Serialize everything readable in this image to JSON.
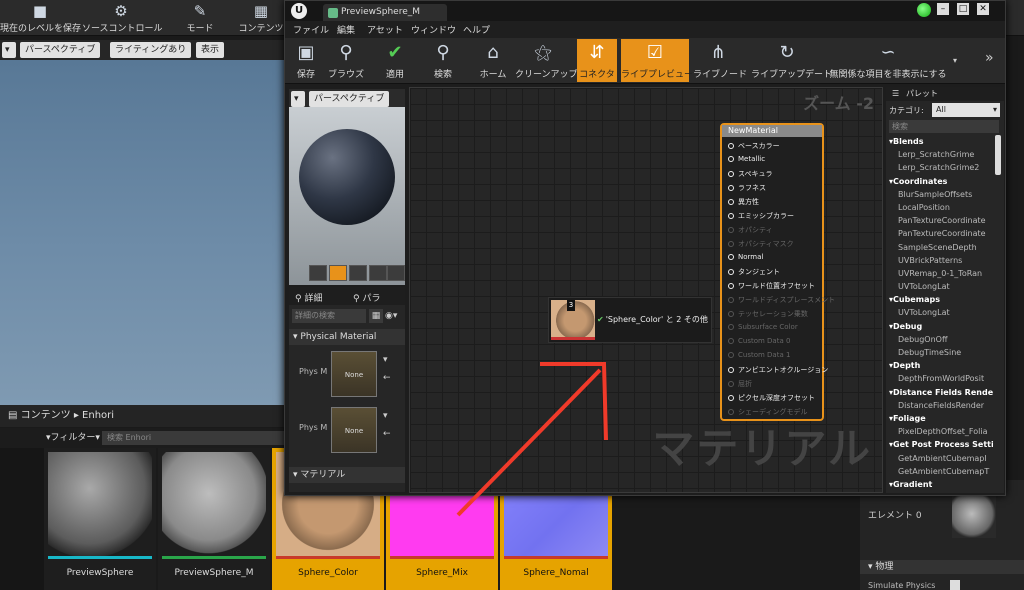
{
  "main_toolbar": {
    "items": [
      {
        "label": "現在のレベルを保存",
        "icon": "save-icon"
      },
      {
        "label": "ソースコントロール",
        "icon": "source-control-icon"
      },
      {
        "label": "モード",
        "icon": "modes-icon"
      },
      {
        "label": "コンテンツ",
        "icon": "content-icon"
      }
    ]
  },
  "left_viewport": {
    "perspective": "パースペクティブ",
    "lighting": "ライティングあり",
    "show": "表示"
  },
  "content_browser": {
    "title": "コンテンツ",
    "path": "Enhori",
    "filter_label": "フィルター",
    "search_placeholder": "検索 Enhori",
    "assets": [
      {
        "name": "PreviewSphere",
        "selected": false,
        "color": "#18b8c8"
      },
      {
        "name": "PreviewSphere_M",
        "selected": false,
        "color": "#2aa64a"
      },
      {
        "name": "Sphere_Color",
        "selected": true,
        "color": "#c83a2a"
      },
      {
        "name": "Sphere_Mix",
        "selected": true,
        "color": "#c83a2a"
      },
      {
        "name": "Sphere_Nomal",
        "selected": true,
        "color": "#c83a2a"
      }
    ]
  },
  "right_panel": {
    "element_label": "エレメント 0",
    "physics_header": "物理",
    "simulate_physics": "Simulate Physics"
  },
  "material_editor": {
    "tab_title": "PreviewSphere_M",
    "menu": [
      "ファイル",
      "編集",
      "アセット",
      "ウィンドウ",
      "ヘルプ"
    ],
    "toolbar": [
      {
        "label": "保存",
        "icon": "save-icon",
        "active": false
      },
      {
        "label": "ブラウズ",
        "icon": "browse-icon",
        "active": false
      },
      {
        "label": "適用",
        "icon": "apply-icon",
        "active": false
      },
      {
        "label": "検索",
        "icon": "search-icon",
        "active": false
      },
      {
        "label": "ホーム",
        "icon": "home-icon",
        "active": false
      },
      {
        "label": "クリーンアップ",
        "icon": "cleanup-icon",
        "active": false
      },
      {
        "label": "コネクタ",
        "icon": "connector-icon",
        "active": true
      },
      {
        "label": "ライブプレビュー",
        "icon": "live-preview-icon",
        "active": true
      },
      {
        "label": "ライブノード",
        "icon": "live-nodes-icon",
        "active": false
      },
      {
        "label": "ライブアップデート",
        "icon": "live-update-icon",
        "active": false
      },
      {
        "label": "無関係な項目を非表示にする",
        "icon": "hide-unrelated-icon",
        "active": false
      }
    ],
    "preview": {
      "perspective": "パースペクティブ"
    },
    "details": {
      "tab_details": "詳細",
      "tab_params": "パラ",
      "search_placeholder": "詳細の検索",
      "section_physical": "Physical Material",
      "phys_label": "Phys M",
      "phys_value": "None",
      "section_material": "マテリアル"
    },
    "graph": {
      "zoom": "ズーム -2",
      "watermark": "マテリアル",
      "node_title": "NewMaterial",
      "pins": [
        {
          "label": "ベースカラー",
          "enabled": true
        },
        {
          "label": "Metallic",
          "enabled": true
        },
        {
          "label": "スペキュラ",
          "enabled": true
        },
        {
          "label": "ラフネス",
          "enabled": true
        },
        {
          "label": "異方性",
          "enabled": true
        },
        {
          "label": "エミッシブカラー",
          "enabled": true
        },
        {
          "label": "オパシティ",
          "enabled": false
        },
        {
          "label": "オパシティマスク",
          "enabled": false
        },
        {
          "label": "Normal",
          "enabled": true
        },
        {
          "label": "タンジェント",
          "enabled": true
        },
        {
          "label": "ワールド位置オフセット",
          "enabled": true
        },
        {
          "label": "ワールドディスプレースメント",
          "enabled": false
        },
        {
          "label": "テッセレーション乗数",
          "enabled": false
        },
        {
          "label": "Subsurface Color",
          "enabled": false
        },
        {
          "label": "Custom Data 0",
          "enabled": false
        },
        {
          "label": "Custom Data 1",
          "enabled": false
        },
        {
          "label": "アンビエントオクルージョン",
          "enabled": true
        },
        {
          "label": "屈折",
          "enabled": false
        },
        {
          "label": "ピクセル深度オフセット",
          "enabled": true
        },
        {
          "label": "シェーディングモデル",
          "enabled": false
        }
      ],
      "drag": {
        "count": "3",
        "text": "'Sphere_Color' と 2 その他"
      }
    },
    "palette": {
      "title": "パレット",
      "category_label": "カテゴリ:",
      "category_value": "All",
      "search_placeholder": "検索",
      "rows": [
        {
          "text": "Blends",
          "head": true
        },
        {
          "text": "Lerp_ScratchGrime",
          "head": false
        },
        {
          "text": "Lerp_ScratchGrime2",
          "head": false
        },
        {
          "text": "Coordinates",
          "head": true
        },
        {
          "text": "BlurSampleOffsets",
          "head": false
        },
        {
          "text": "LocalPosition",
          "head": false
        },
        {
          "text": "PanTextureCoordinate",
          "head": false
        },
        {
          "text": "PanTextureCoordinate",
          "head": false
        },
        {
          "text": "SampleSceneDepth",
          "head": false
        },
        {
          "text": "UVBrickPatterns",
          "head": false
        },
        {
          "text": "UVRemap_0-1_ToRan",
          "head": false
        },
        {
          "text": "UVToLongLat",
          "head": false
        },
        {
          "text": "Cubemaps",
          "head": true
        },
        {
          "text": "UVToLongLat",
          "head": false
        },
        {
          "text": "Debug",
          "head": true
        },
        {
          "text": "DebugOnOff",
          "head": false
        },
        {
          "text": "DebugTimeSine",
          "head": false
        },
        {
          "text": "Depth",
          "head": true
        },
        {
          "text": "DepthFromWorldPosit",
          "head": false
        },
        {
          "text": "Distance Fields Renderin",
          "head": true
        },
        {
          "text": "DistanceFieldsRender",
          "head": false
        },
        {
          "text": "Foliage",
          "head": true
        },
        {
          "text": "PixelDepthOffset_Folia",
          "head": false
        },
        {
          "text": "Get Post Process Setting",
          "head": true
        },
        {
          "text": "GetAmbientCubemapI",
          "head": false
        },
        {
          "text": "GetAmbientCubemapT",
          "head": false
        },
        {
          "text": "Gradient",
          "head": true
        }
      ]
    }
  },
  "colors": {
    "accent": "#e8921a",
    "annotation_arrow": "#f03a2a"
  }
}
